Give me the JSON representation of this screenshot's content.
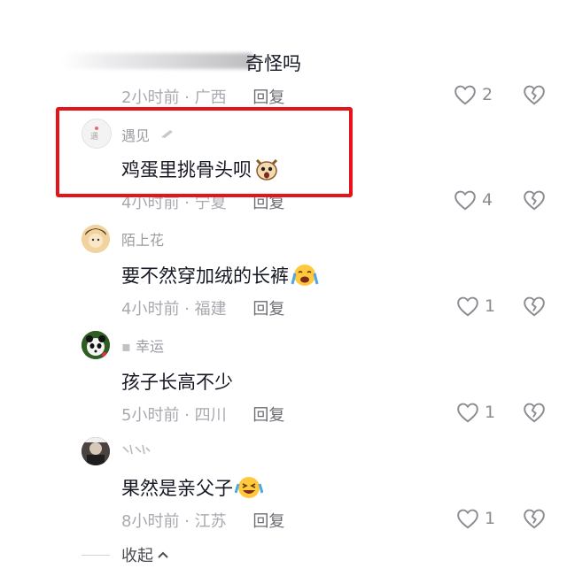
{
  "comments": [
    {
      "username": "",
      "text": "奇怪吗",
      "time": "2小时前",
      "location": "广西",
      "reply_label": "回复",
      "likes": "2"
    },
    {
      "username": "遇见",
      "text": "鸡蛋里挑骨头呗",
      "time": "4小时前",
      "location": "宁夏",
      "reply_label": "回复",
      "likes": "4"
    },
    {
      "username": "陌上花",
      "text": "要不然穿加绒的长裤",
      "time": "4小时前",
      "location": "福建",
      "reply_label": "回复",
      "likes": "1"
    },
    {
      "username": "幸运",
      "text": "孩子长高不少",
      "time": "5小时前",
      "location": "四川",
      "reply_label": "回复",
      "likes": "1"
    },
    {
      "username": "",
      "text": "果然是亲父子",
      "time": "8小时前",
      "location": "江苏",
      "reply_label": "回复",
      "likes": "1"
    }
  ],
  "separator": "·",
  "collapse_label": "收起",
  "colors": {
    "highlight_border": "#e4141a",
    "text": "#161823",
    "meta": "#a8aab0"
  }
}
